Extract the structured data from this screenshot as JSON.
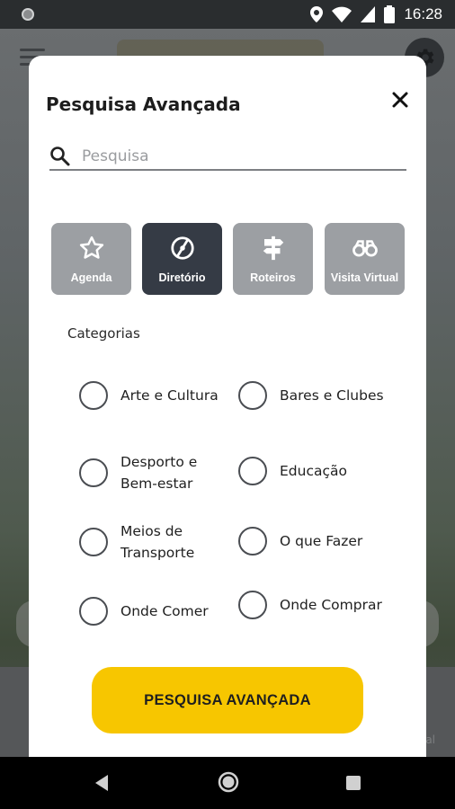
{
  "status_bar": {
    "time": "16:28"
  },
  "modal": {
    "title": "Pesquisa Avançada",
    "search": {
      "placeholder": "Pesquisa",
      "value": ""
    },
    "tabs": [
      {
        "label": "Agenda",
        "icon": "star-icon",
        "active": false
      },
      {
        "label": "Diretório",
        "icon": "compass-icon",
        "active": true
      },
      {
        "label": "Roteiros",
        "icon": "signpost-icon",
        "active": false
      },
      {
        "label": "Visita Virtual",
        "icon": "binoculars-icon",
        "active": false
      }
    ],
    "categories_label": "Categorias",
    "categories": [
      {
        "label": "Arte e Cultura",
        "selected": false
      },
      {
        "label": "Bares e Clubes",
        "selected": false
      },
      {
        "label": "Desporto e Bem-estar",
        "selected": false
      },
      {
        "label": "Educação",
        "selected": false
      },
      {
        "label": "Meios de Transporte",
        "selected": false
      },
      {
        "label": "O que Fazer",
        "selected": false
      },
      {
        "label": "Onde Comer",
        "selected": false
      },
      {
        "label": "Onde Comprar",
        "selected": false
      }
    ],
    "submit_label": "PESQUISA AVANÇADA"
  },
  "background": {
    "bottom_partial_text": "al"
  },
  "colors": {
    "accent": "#f7c600",
    "tab_active": "#353b45",
    "tab_inactive": "#9c9fa3"
  }
}
